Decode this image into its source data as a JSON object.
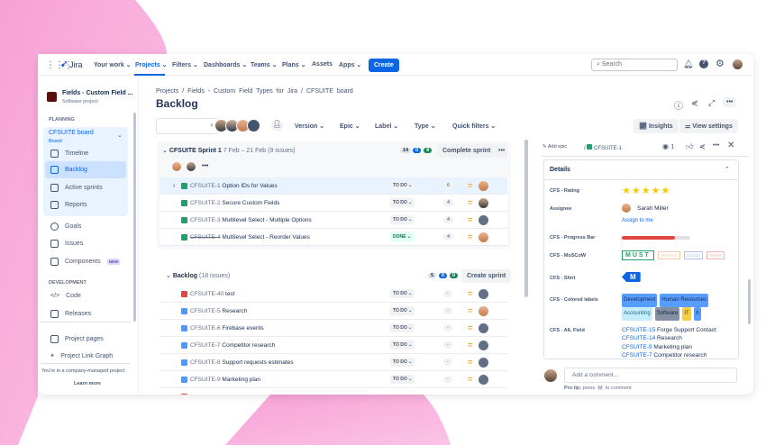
{
  "colors": {
    "accent": "#0c66e4",
    "pink": "#f7a3d8",
    "progress": "#e2483d"
  },
  "nav": {
    "app": "Jira",
    "items": [
      "Your work",
      "Projects",
      "Filters",
      "Dashboards",
      "Teams",
      "Plans",
      "Assets",
      "Apps"
    ],
    "create": "Create",
    "search_placeholder": "Search"
  },
  "sidebar": {
    "project_name": "Fields - Custom Field ...",
    "project_type": "Software project",
    "planning": "PLANNING",
    "board": "CFSUITE board",
    "board_sub": "Board",
    "board_items": [
      "Timeline",
      "Backlog",
      "Active sprints",
      "Reports"
    ],
    "items": [
      "Goals",
      "Issues",
      "Components"
    ],
    "new_badge": "NEW",
    "development": "DEVELOPMENT",
    "dev_items": [
      "Code",
      "Releases"
    ],
    "extra": [
      "Project pages",
      "Project Link Graph"
    ],
    "footer": "You're in a company-managed project",
    "learn_more": "Learn more"
  },
  "main": {
    "breadcrumb": [
      "Projects",
      "/",
      "Fields - Custom Field Types for Jira",
      "/",
      "CFSUITE board"
    ],
    "title": "Backlog",
    "filters": [
      "Version",
      "Epic",
      "Label",
      "Type",
      "Quick filters"
    ],
    "insights": "Insights",
    "view_settings": "View settings"
  },
  "sprint": {
    "name": "CFSUITE Sprint 1",
    "dates": "7 Feb – 21 Feb",
    "count": "(9 issues)",
    "badges": [
      "14",
      "0",
      "4"
    ],
    "action": "Complete sprint",
    "rows": [
      {
        "key": "CFSUITE-1",
        "title": "Option IDs for Values",
        "status": "TO DO",
        "points": "6",
        "av": "f"
      },
      {
        "key": "CFSUITE-2",
        "title": "Secure Custom Fields",
        "status": "TO DO",
        "points": "4",
        "av": "m"
      },
      {
        "key": "CFSUITE-3",
        "title": "Multilevel Select - Multiple Options",
        "status": "TO DO",
        "points": "4",
        "av": "u"
      },
      {
        "key": "CFSUITE-4",
        "title": "Multilevel Select - Reorder Values",
        "status": "DONE",
        "points": "4",
        "av": "f"
      }
    ]
  },
  "backlog": {
    "name": "Backlog",
    "count": "(18 issues)",
    "badges": [
      "5",
      "0",
      "0"
    ],
    "action": "Create sprint",
    "rows": [
      {
        "key": "CFSUITE-40",
        "title": "test",
        "status": "TO DO",
        "points": "-",
        "av": "u",
        "type": "bug"
      },
      {
        "key": "CFSUITE-5",
        "title": "Research",
        "status": "TO DO",
        "points": "-",
        "av": "f",
        "type": "task"
      },
      {
        "key": "CFSUITE-6",
        "title": "Firebase events",
        "status": "TO DO",
        "points": "-",
        "av": "u",
        "type": "task"
      },
      {
        "key": "CFSUITE-7",
        "title": "Competitor research",
        "status": "TO DO",
        "points": "-",
        "av": "u",
        "type": "task"
      },
      {
        "key": "CFSUITE-8",
        "title": "Support requests estimates",
        "status": "TO DO",
        "points": "-",
        "av": "u",
        "type": "task"
      },
      {
        "key": "CFSUITE-9",
        "title": "Marketing plan",
        "status": "TO DO",
        "points": "-",
        "av": "u",
        "type": "task"
      }
    ]
  },
  "detail": {
    "add_epic": "Add epic",
    "key": "CFSUITE-1",
    "watchers": "1",
    "details": "Details",
    "rating_label": "CFS - Rating",
    "rating": 5,
    "assignee_label": "Assignee",
    "assignee": "Sarah Miller",
    "assign_me": "Assign to me",
    "progress_label": "CFS - Progress Bar",
    "progress": 0.78,
    "moscow_label": "CFS - MoSCoW",
    "moscow": [
      "MUST",
      "SHOULD",
      "COULD",
      "WONT"
    ],
    "shirt_label": "CFS - Shirt",
    "shirt": "M",
    "labels_label": "CFS - Colored labels",
    "labels": [
      "Development",
      "Human Resources",
      "Accounting",
      "Software",
      "IT",
      "X"
    ],
    "ail_label": "CFS - AIL Field",
    "ail": [
      {
        "key": "CFSUITE-15",
        "title": "Forge Support Contact"
      },
      {
        "key": "CFSUITE-14",
        "title": "Research"
      },
      {
        "key": "CFSUITE-9",
        "title": "Marketing plan"
      },
      {
        "key": "CFSUITE-7",
        "title": "Competitor research"
      }
    ],
    "comment_placeholder": "Add a comment...",
    "pro_tip_a": "Pro tip:",
    "pro_tip_b": "press",
    "pro_tip_key": "M",
    "pro_tip_c": "to comment"
  }
}
